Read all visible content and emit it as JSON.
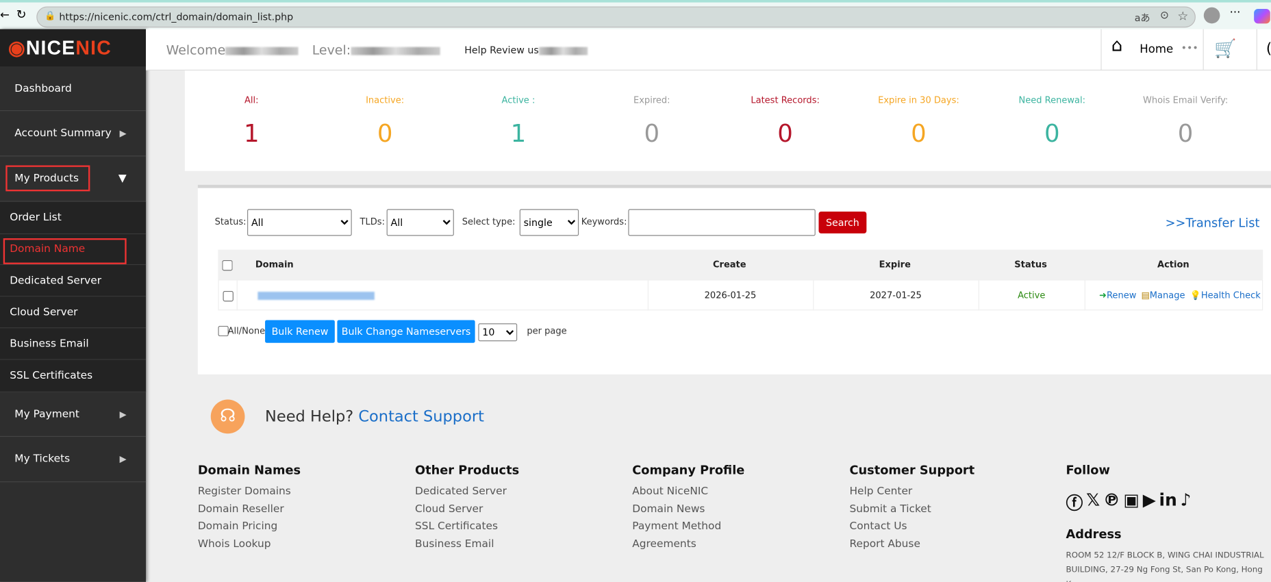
{
  "browser": {
    "url": "https://nicenic.com/ctrl_domain/domain_list.php"
  },
  "logo": {
    "part1": "NICE",
    "part2": "NIC"
  },
  "sidebar": {
    "items": [
      {
        "label": "Dashboard"
      },
      {
        "label": "Account Summary"
      },
      {
        "label": "My Products"
      },
      {
        "label": "My Payment"
      },
      {
        "label": "My Tickets"
      }
    ],
    "subitems": [
      {
        "label": "Order List"
      },
      {
        "label": "Domain Name"
      },
      {
        "label": "Dedicated Server"
      },
      {
        "label": "Cloud Server"
      },
      {
        "label": "Business Email"
      },
      {
        "label": "SSL Certificates"
      }
    ]
  },
  "header": {
    "welcome": "Welcome",
    "level": "Level:",
    "help_review": "Help Review us",
    "home": "Home"
  },
  "stats": [
    {
      "label": "All:",
      "value": "1",
      "color": "#b5162b"
    },
    {
      "label": "Inactive:",
      "value": "0",
      "color": "#f5a623"
    },
    {
      "label": "Active :",
      "value": "1",
      "color": "#3cb4a0"
    },
    {
      "label": "Expired:",
      "value": "0",
      "color": "#999999"
    },
    {
      "label": "Latest Records:",
      "value": "0",
      "color": "#b5162b"
    },
    {
      "label": "Expire in 30 Days:",
      "value": "0",
      "color": "#f5a623"
    },
    {
      "label": "Need Renewal:",
      "value": "0",
      "color": "#3cb4a0"
    },
    {
      "label": "Whois Email Verify:",
      "value": "0",
      "color": "#999999"
    }
  ],
  "filters": {
    "status_label": "Status:",
    "status_value": "All",
    "tlds_label": "TLDs:",
    "tlds_value": "All",
    "type_label": "Select type:",
    "type_value": "single",
    "keywords_label": "Keywords:",
    "keywords_value": "",
    "search": "Search",
    "transfer_list": ">>Transfer List"
  },
  "table": {
    "headers": [
      "Domain",
      "Create",
      "Expire",
      "Status",
      "Action"
    ],
    "rows": [
      {
        "create": "2026-01-25",
        "expire": "2027-01-25",
        "status": "Active",
        "actions": [
          "Renew",
          "Manage",
          "Health Check"
        ]
      }
    ]
  },
  "bulk": {
    "all_none": "All/None",
    "bulk_renew": "Bulk Renew",
    "bulk_ns": "Bulk Change Nameservers",
    "per_page_value": "10",
    "per_page": "per page"
  },
  "help": {
    "text": "Need Help?",
    "link": "Contact Support"
  },
  "footer": {
    "columns": [
      {
        "title": "Domain Names",
        "links": [
          "Register Domains",
          "Domain Reseller",
          "Domain Pricing",
          "Whois Lookup"
        ]
      },
      {
        "title": "Other Products",
        "links": [
          "Dedicated Server",
          "Cloud Server",
          "SSL Certificates",
          "Business Email"
        ]
      },
      {
        "title": "Company Profile",
        "links": [
          "About NiceNIC",
          "Domain News",
          "Payment Method",
          "Agreements"
        ]
      },
      {
        "title": "Customer Support",
        "links": [
          "Help Center",
          "Submit a Ticket",
          "Contact Us",
          "Report Abuse"
        ]
      }
    ],
    "follow": "Follow",
    "address_title": "Address",
    "address": "ROOM 52 12/F BLOCK B, WING CHAI INDUSTRIAL BUILDING, 27-29 Ng Fong St, San Po Kong, Hong Kong"
  }
}
